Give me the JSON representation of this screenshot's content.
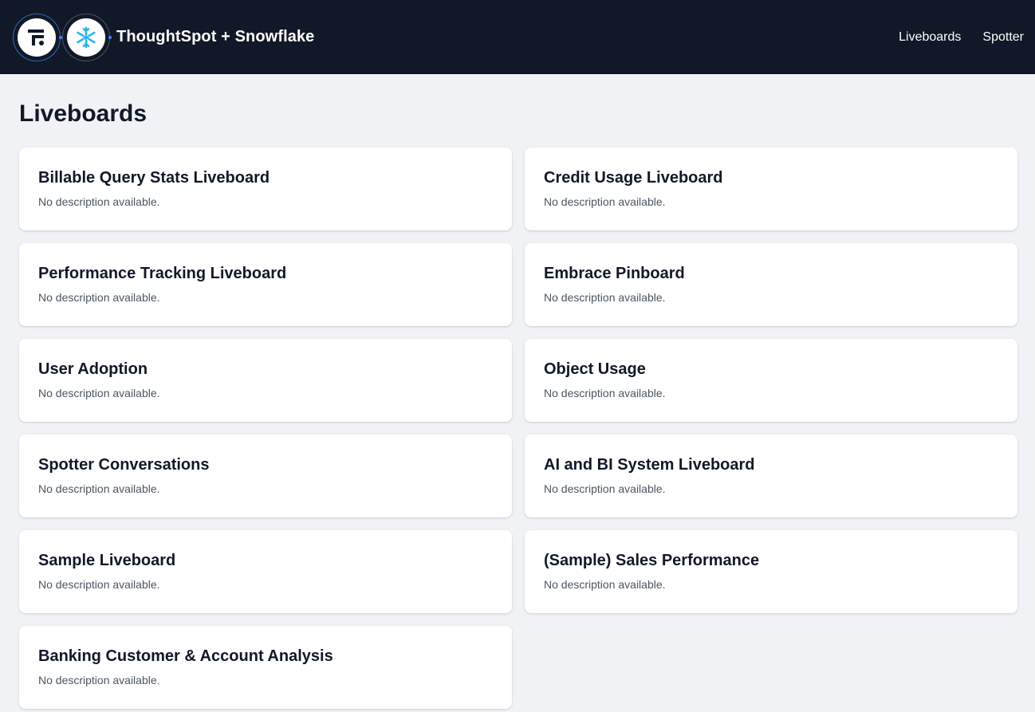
{
  "header": {
    "title": "ThoughtSpot + Snowflake",
    "logos": [
      "thoughtspot-logo-icon",
      "snowflake-logo-icon"
    ],
    "nav": [
      {
        "label": "Liveboards"
      },
      {
        "label": "Spotter"
      }
    ]
  },
  "main": {
    "title": "Liveboards",
    "cards": [
      {
        "title": "Billable Query Stats Liveboard",
        "description": "No description available."
      },
      {
        "title": "Credit Usage Liveboard",
        "description": "No description available."
      },
      {
        "title": "Performance Tracking Liveboard",
        "description": "No description available."
      },
      {
        "title": "Embrace Pinboard",
        "description": "No description available."
      },
      {
        "title": "User Adoption",
        "description": "No description available."
      },
      {
        "title": "Object Usage",
        "description": "No description available."
      },
      {
        "title": "Spotter Conversations",
        "description": "No description available."
      },
      {
        "title": "AI and BI System Liveboard",
        "description": "No description available."
      },
      {
        "title": "Sample Liveboard",
        "description": "No description available."
      },
      {
        "title": "(Sample) Sales Performance",
        "description": "No description available."
      },
      {
        "title": "Banking Customer & Account Analysis",
        "description": "No description available."
      }
    ]
  },
  "colors": {
    "header_bg": "#111827",
    "page_bg": "#f0f2f5",
    "card_bg": "#ffffff",
    "snowflake_blue": "#29b5e8"
  }
}
